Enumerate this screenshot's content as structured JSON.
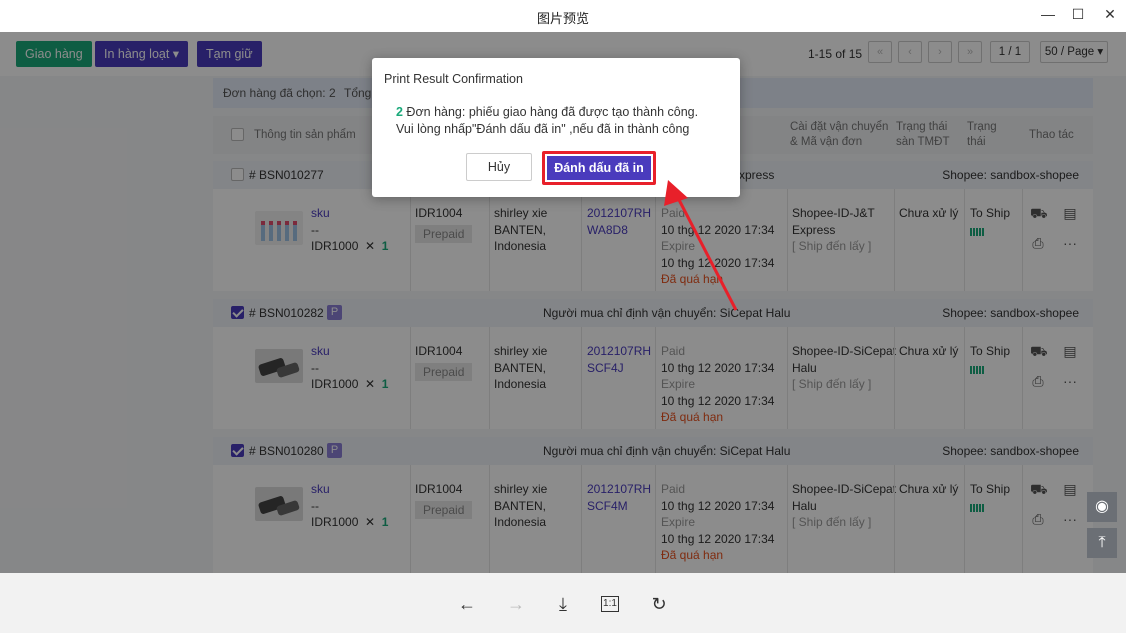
{
  "window": {
    "title": "图片预览",
    "minimize": "—",
    "maximize": "☐",
    "close": "✕"
  },
  "toolbar": {
    "ship_label": "Giao hàng",
    "bulk_print_label": "In hàng loạt ▾",
    "hold_label": "Tạm giữ",
    "range": "1-15 of 15",
    "first": "«",
    "prev": "‹",
    "next": "›",
    "last": "»",
    "page": "1 / 1",
    "per_page": "50 / Page ▾"
  },
  "selection": {
    "selected": "Đơn hàng đã chọn: 2",
    "total": "Tổng"
  },
  "table_header": {
    "product": "Thông tin sản phẩm",
    "shipping_setup": "Cài đặt vận chuyển\n& Mã vận đơn",
    "platform_status": "Trạng thái\nsàn TMĐT",
    "status": "Trạng\nthái",
    "actions": "Thao tác"
  },
  "orders": [
    {
      "id": "# BSN010277",
      "checked": false,
      "badge": "",
      "carrier_note": "Express",
      "shop": "Shopee: sandbox-shopee",
      "sku": "sku",
      "dash": "--",
      "price": "IDR1000",
      "times": "✕",
      "qty": "1",
      "amount": "IDR1004",
      "payment": "Prepaid",
      "buyer1": "shirley xie",
      "buyer2": "BANTEN,",
      "buyer3": "Indonesia",
      "track1": "2012107RH",
      "track2": "WA8D8",
      "paid": "Paid",
      "paid_time": "10 thg 12 2020 17:34",
      "expire": "Expire",
      "expire_time": "10 thg 12 2020 17:34",
      "overdue": "Đã quá hạn",
      "ship1": "Shopee-ID-J&T",
      "ship2": "Express",
      "ship3": "[ Ship đến lấy ]",
      "platform": "Chưa xử lý",
      "state": "To Ship"
    },
    {
      "id": "# BSN010282",
      "checked": true,
      "badge": "P",
      "carrier_note": "Người mua chỉ định vận chuyển: SiCepat Halu",
      "shop": "Shopee: sandbox-shopee",
      "sku": "sku",
      "dash": "--",
      "price": "IDR1000",
      "times": "✕",
      "qty": "1",
      "amount": "IDR1004",
      "payment": "Prepaid",
      "buyer1": "shirley xie",
      "buyer2": "BANTEN,",
      "buyer3": "Indonesia",
      "track1": "2012107RH",
      "track2": "SCF4J",
      "paid": "Paid",
      "paid_time": "10 thg 12 2020 17:34",
      "expire": "Expire",
      "expire_time": "10 thg 12 2020 17:34",
      "overdue": "Đã quá hạn",
      "ship1": "Shopee-ID-SiCepat",
      "ship2": "Halu",
      "ship3": "[ Ship đến lấy ]",
      "platform": "Chưa xử lý",
      "state": "To Ship"
    },
    {
      "id": "# BSN010280",
      "checked": true,
      "badge": "P",
      "carrier_note": "Người mua chỉ định vận chuyển: SiCepat Halu",
      "shop": "Shopee: sandbox-shopee",
      "sku": "sku",
      "dash": "--",
      "price": "IDR1000",
      "times": "✕",
      "qty": "1",
      "amount": "IDR1004",
      "payment": "Prepaid",
      "buyer1": "shirley xie",
      "buyer2": "BANTEN,",
      "buyer3": "Indonesia",
      "track1": "2012107RH",
      "track2": "SCF4M",
      "paid": "Paid",
      "paid_time": "10 thg 12 2020 17:34",
      "expire": "Expire",
      "expire_time": "10 thg 12 2020 17:34",
      "overdue": "Đã quá hạn",
      "ship1": "Shopee-ID-SiCepat",
      "ship2": "Halu",
      "ship3": "[ Ship đến lấy ]",
      "platform": "Chưa xử lý",
      "state": "To Ship"
    }
  ],
  "dialog": {
    "title": "Print Result Confirmation",
    "count": "2",
    "line1": " Đơn hàng: phiếu giao hàng đã được tạo thành công.",
    "line2": "Vui lòng nhấp\"Đánh dấu đã in\" ,nếu đã in thành công",
    "cancel": "Hủy",
    "confirm": "Đánh dấu đã in"
  },
  "bottom": {
    "back": "←",
    "forward": "→",
    "download": "⤓",
    "actual_size": "1:1",
    "rotate": "↻"
  },
  "colors": {
    "accent": "#4a3bbd",
    "green": "#1aa97a",
    "highlight": "#e8202a",
    "overdue": "#e8501e"
  }
}
